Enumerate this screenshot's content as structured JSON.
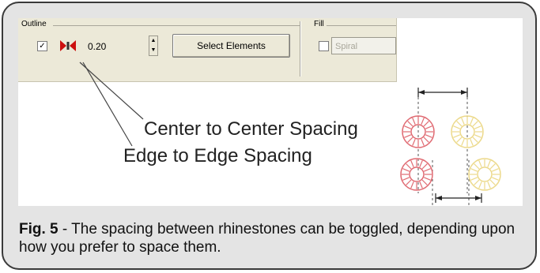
{
  "toolbar": {
    "outline_group": {
      "label": "Outline",
      "checkbox_mark": "✓",
      "spacing_icon": "spacing-mode-icon",
      "spacing_value": "0.20",
      "spin_up": "▲",
      "spin_down": "▼",
      "select_button_label": "Select Elements"
    },
    "fill_group": {
      "label": "Fill",
      "select_value": "Spiral"
    }
  },
  "callouts": {
    "center": "Center to Center Spacing",
    "edge": "Edge to Edge Spacing"
  },
  "caption": {
    "fig_label": "Fig. 5",
    "text": " - The spacing between rhinestones can be toggled, depending upon how you prefer to space them."
  },
  "colors": {
    "red_stone": "#e06a72",
    "yellow_stone": "#ecd98a",
    "icon_red": "#cc1010"
  }
}
